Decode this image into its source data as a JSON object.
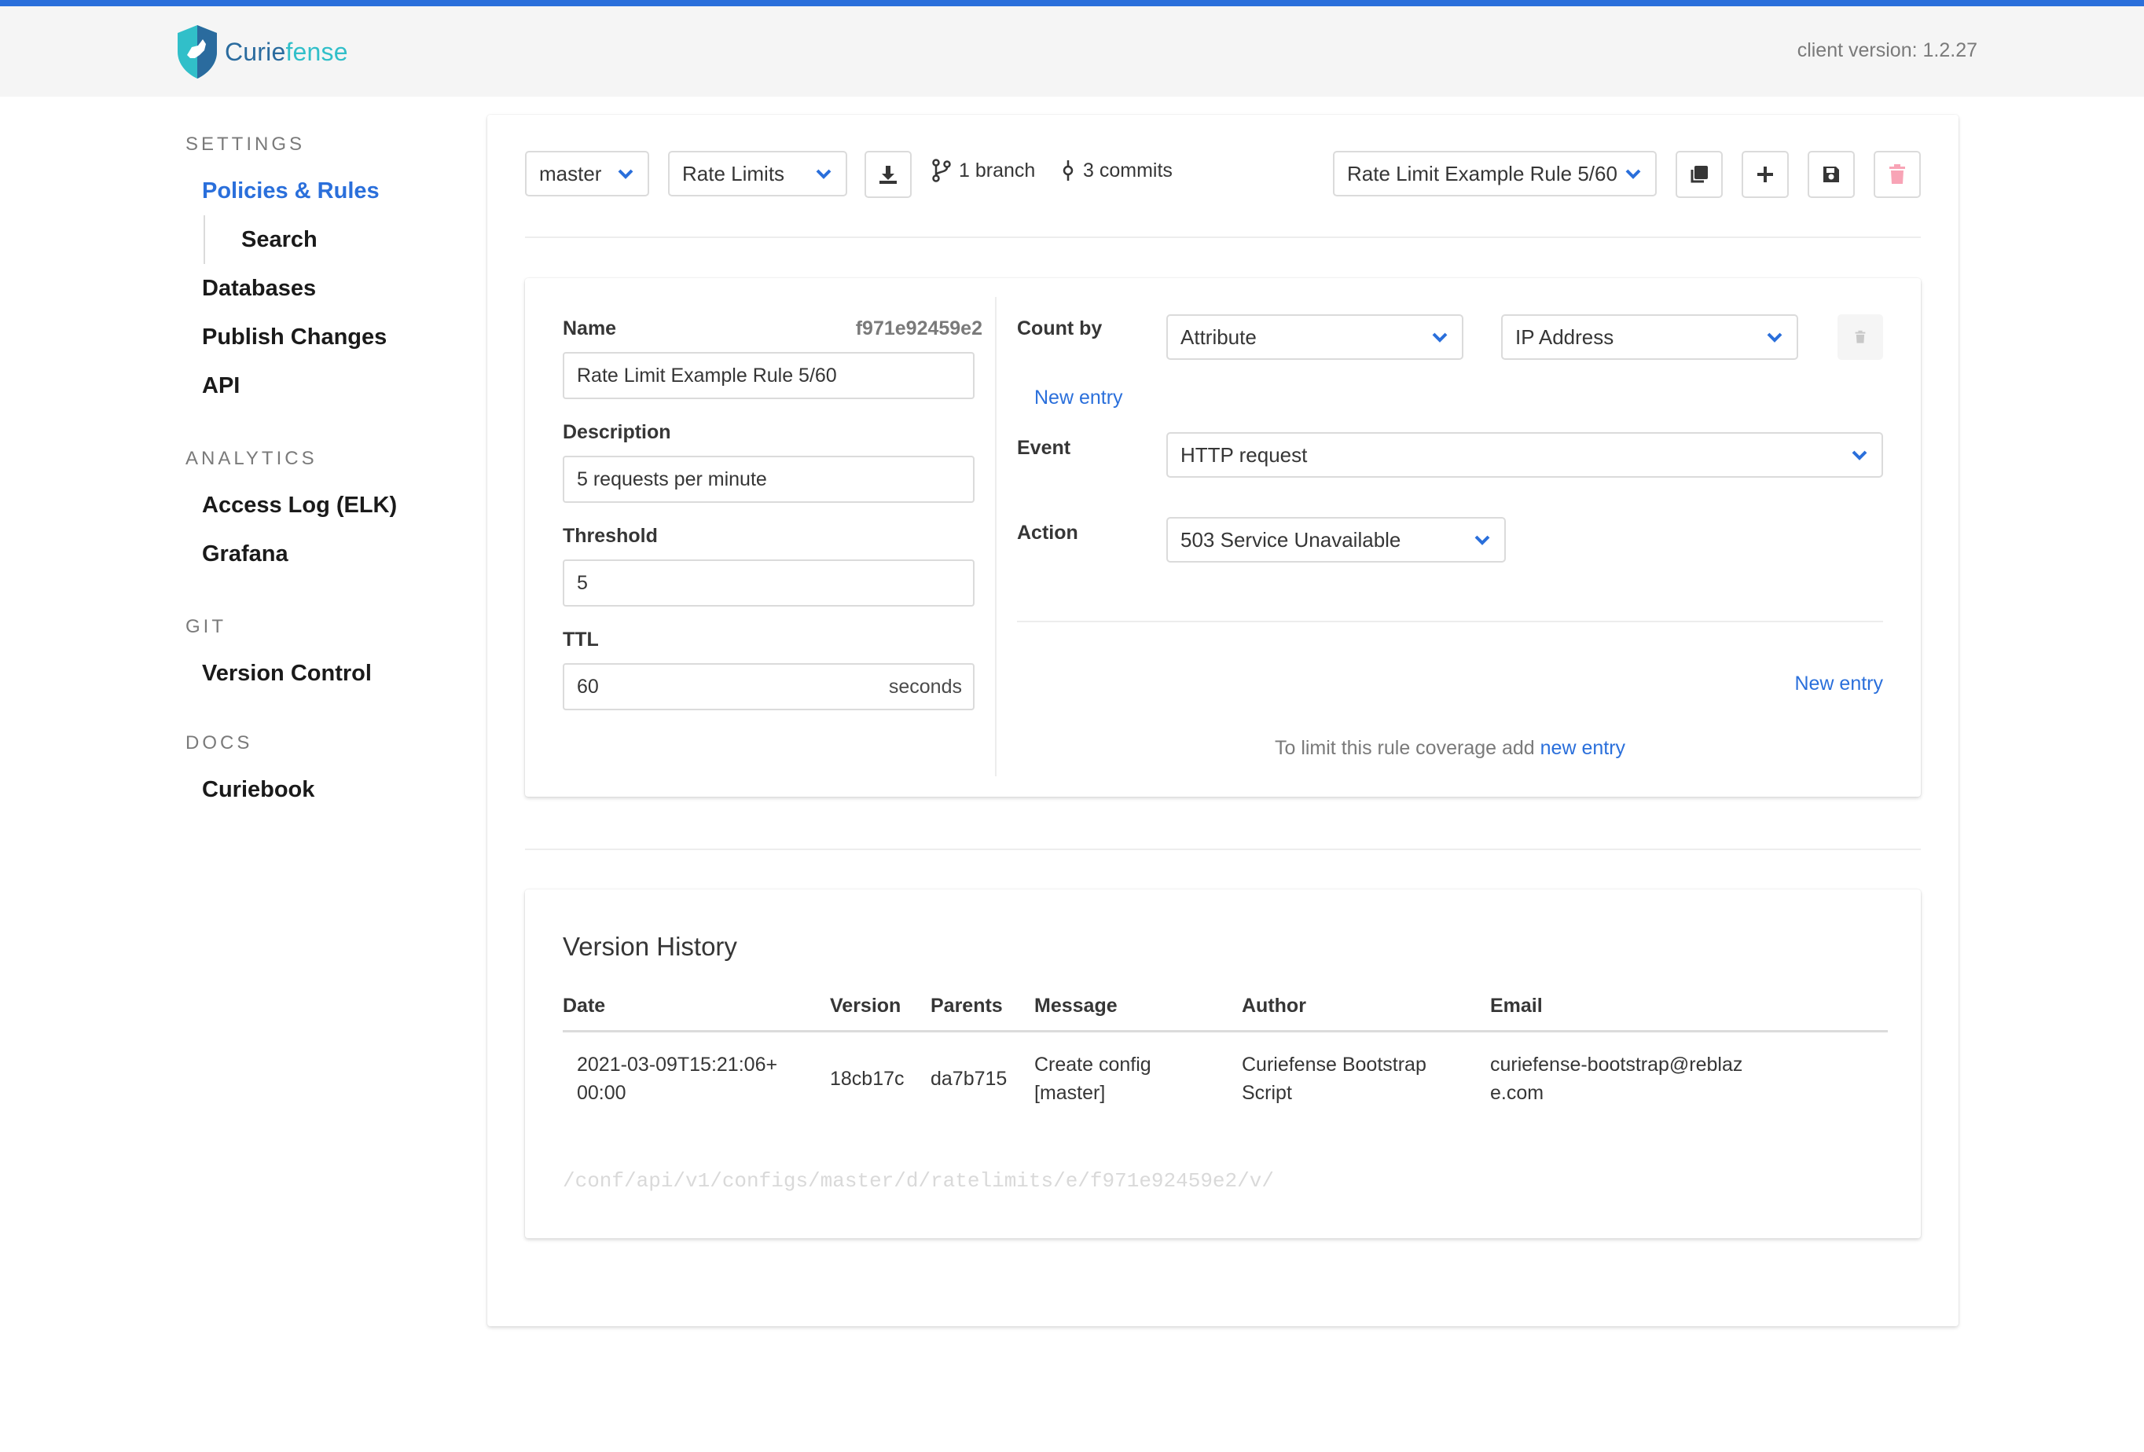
{
  "header": {
    "logo_text_a": "Curie",
    "logo_text_b": "fense",
    "client_version": "client version: 1.2.27"
  },
  "sidebar": {
    "groups": [
      {
        "label": "SETTINGS",
        "items": [
          "Policies & Rules",
          "Search",
          "Databases",
          "Publish Changes",
          "API"
        ]
      },
      {
        "label": "ANALYTICS",
        "items": [
          "Access Log (ELK)",
          "Grafana"
        ]
      },
      {
        "label": "GIT",
        "items": [
          "Version Control"
        ]
      },
      {
        "label": "DOCS",
        "items": [
          "Curiebook"
        ]
      }
    ]
  },
  "toolbar": {
    "branch": "master",
    "doc_type": "Rate Limits",
    "branches": "1 branch",
    "commits": "3 commits",
    "selected_doc": "Rate Limit Example Rule 5/60"
  },
  "form": {
    "name_label": "Name",
    "doc_id": "f971e92459e2",
    "name_value": "Rate Limit Example Rule 5/60",
    "description_label": "Description",
    "description_value": "5 requests per minute",
    "threshold_label": "Threshold",
    "threshold_value": "5",
    "ttl_label": "TTL",
    "ttl_value": "60",
    "ttl_unit": "seconds",
    "count_by_label": "Count by",
    "count_by_type": "Attribute",
    "count_by_value": "IP Address",
    "new_entry_count": "New entry",
    "event_label": "Event",
    "event_value": "HTTP request",
    "action_label": "Action",
    "action_value": "503 Service Unavailable",
    "new_entry": "New entry",
    "coverage_text": "To limit this rule coverage add",
    "coverage_link": "new entry"
  },
  "version_history": {
    "title": "Version History",
    "columns": [
      "Date",
      "Version",
      "Parents",
      "Message",
      "Author",
      "Email"
    ],
    "rows": [
      [
        "2021-03-09T15:21:06+00:00",
        "18cb17c",
        "da7b715",
        "Create config [master]",
        "Curiefense Bootstrap Script",
        "curiefense-bootstrap@reblaze.com"
      ]
    ],
    "api_path": "/conf/api/v1/configs/master/d/ratelimits/e/f971e92459e2/v/"
  },
  "colors": {
    "accent": "#2a6fdb",
    "danger": "#f14668",
    "logo_dark": "#2a6b9e",
    "logo_light": "#31bfc9"
  }
}
